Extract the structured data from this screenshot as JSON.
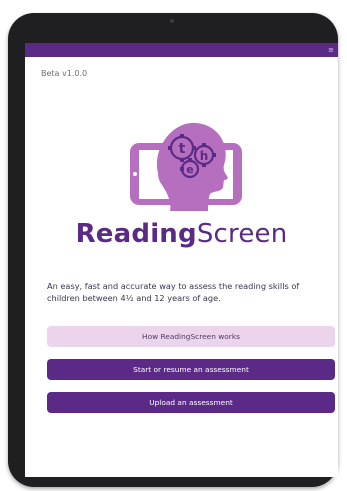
{
  "app": {
    "version": "Beta v1.0.0",
    "name_bold": "Reading",
    "name_regular": "Screen",
    "tagline": "An easy, fast and accurate way to assess the reading skills of children between 4½ and 12 years of age.",
    "logo_letters": [
      "t",
      "h",
      "e"
    ]
  },
  "buttons": {
    "how": "How ReadingScreen works",
    "start": "Start or resume an assessment",
    "upload": "Upload an assessment"
  },
  "status_bar": {
    "glyph": "≡"
  },
  "colors": {
    "brand_purple": "#5b2a86",
    "logo_purple": "#b66fbf",
    "light_pink": "#ecd5ec"
  },
  "icons": {
    "logo": "child-head-with-gears-on-tablet-icon"
  }
}
